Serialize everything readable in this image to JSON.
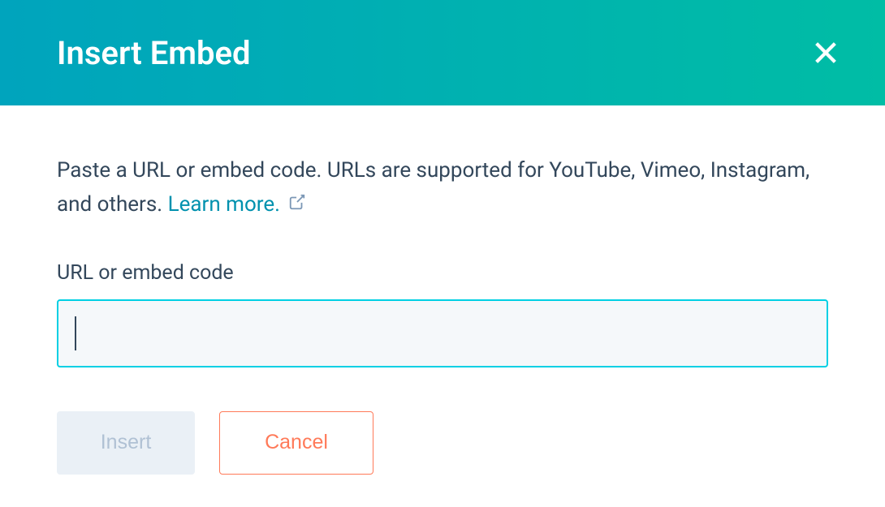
{
  "header": {
    "title": "Insert Embed"
  },
  "body": {
    "description_prefix": "Paste a URL or embed code. URLs are supported for YouTube, Vimeo, Instagram, and others. ",
    "learn_more_label": "Learn more.",
    "field_label": "URL or embed code",
    "input_value": "",
    "input_placeholder": ""
  },
  "buttons": {
    "insert_label": "Insert",
    "cancel_label": "Cancel"
  }
}
